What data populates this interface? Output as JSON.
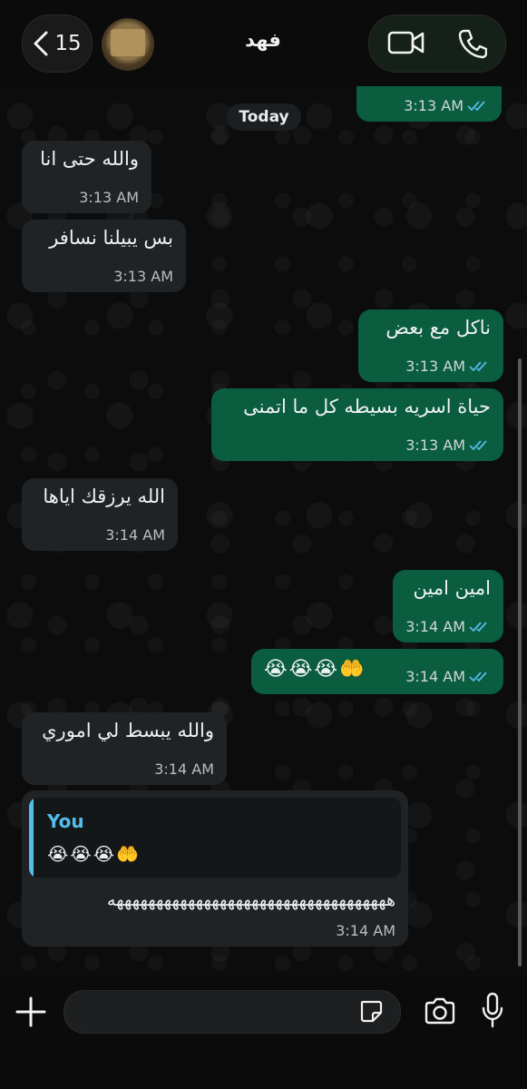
{
  "header": {
    "back_count": "15",
    "contact_name": "فهد"
  },
  "date_chip": "Today",
  "messages": [
    {
      "dir": "out",
      "text": "",
      "time": "3:13 AM"
    },
    {
      "dir": "in",
      "text": "والله حتى انا",
      "time": "3:13 AM"
    },
    {
      "dir": "in",
      "text": "بس يبيلنا نسافر",
      "time": "3:13 AM"
    },
    {
      "dir": "out",
      "text": "ناكل مع بعض",
      "time": "3:13 AM"
    },
    {
      "dir": "out",
      "text": "حياة اسريه بسيطه كل ما اتمنى",
      "time": "3:13 AM"
    },
    {
      "dir": "in",
      "text": "الله يرزقك اياها",
      "time": "3:14 AM"
    },
    {
      "dir": "out",
      "text": "امين امين",
      "time": "3:14 AM"
    },
    {
      "dir": "out",
      "text": "😭😭😭🤲",
      "time": "3:14 AM"
    },
    {
      "dir": "in",
      "text": "والله يبسط لي اموري",
      "time": "3:14 AM"
    },
    {
      "dir": "in",
      "reply_author": "You",
      "reply_text": "😭😭😭🤲",
      "text": "هههههههههههههههههههههههههههههههههههه",
      "time": "3:14 AM"
    }
  ],
  "colors": {
    "outgoing": "#0a5d3f",
    "incoming": "#1f2326",
    "accent": "#53bdeb",
    "ticks": "#53bdeb"
  },
  "icons": [
    "chevron-left-icon",
    "video-call-icon",
    "phone-icon",
    "plus-icon",
    "sticker-icon",
    "camera-icon",
    "mic-icon",
    "double-check-icon"
  ]
}
